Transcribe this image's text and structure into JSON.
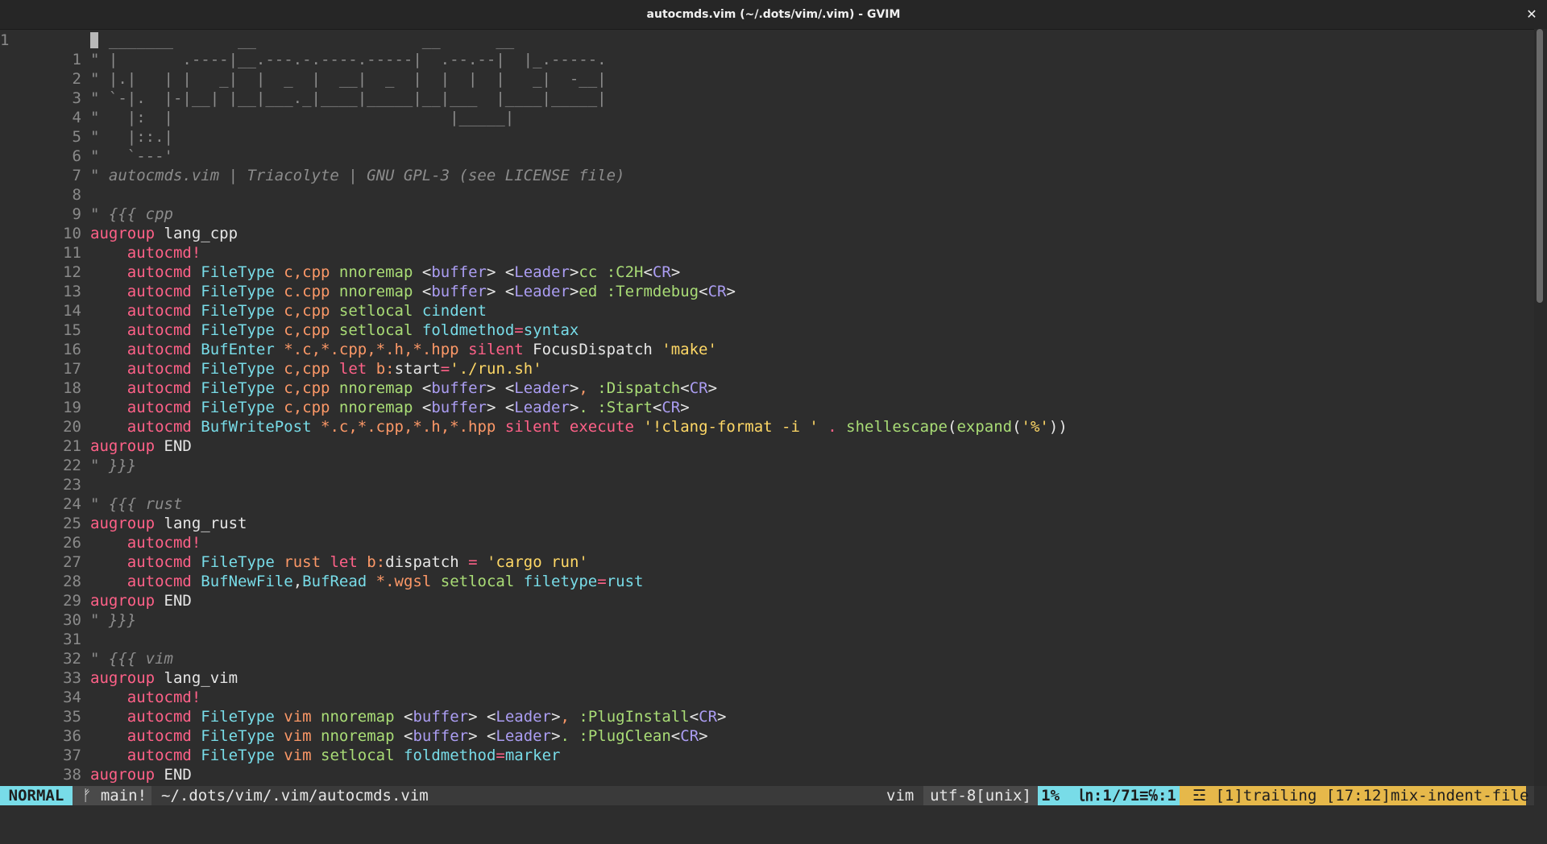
{
  "window": {
    "title": "autocmds.vim (~/.dots/vim/.vim) - GVIM"
  },
  "editor": {
    "current_line_number": "1",
    "lines": [
      {
        "n": "",
        "t": [
          [
            "c",
            "\" _______       __                  __      __"
          ]
        ]
      },
      {
        "n": "1",
        "t": [
          [
            "c",
            "\" |       .----|__.---.-.----.-----|  .--.--|  |_.-----."
          ]
        ]
      },
      {
        "n": "2",
        "t": [
          [
            "c",
            "\" |.|   | |   _|  |  _  |  __|  _  |  |  |  |   _|  -__|"
          ]
        ]
      },
      {
        "n": "3",
        "t": [
          [
            "c",
            "\" `-|.  |-|__| |__|___._|____|_____|__|___  |____|_____|"
          ]
        ]
      },
      {
        "n": "4",
        "t": [
          [
            "c",
            "\"   |:  |                              |_____|"
          ]
        ]
      },
      {
        "n": "5",
        "t": [
          [
            "c",
            "\"   |::.|"
          ]
        ]
      },
      {
        "n": "6",
        "t": [
          [
            "c",
            "\"   `---'"
          ]
        ]
      },
      {
        "n": "7",
        "t": [
          [
            "ci",
            "\" autocmds.vim | Triacolyte | GNU GPL-3 (see LICENSE file)"
          ]
        ]
      },
      {
        "n": "8",
        "t": []
      },
      {
        "n": "9",
        "t": [
          [
            "ci",
            "\" {{{ cpp"
          ]
        ]
      },
      {
        "n": "10",
        "t": [
          [
            "k",
            "augroup"
          ],
          [
            "w",
            " lang_cpp"
          ]
        ]
      },
      {
        "n": "11",
        "t": [
          [
            "w",
            "    "
          ],
          [
            "k",
            "autocmd!"
          ]
        ]
      },
      {
        "n": "12",
        "t": [
          [
            "w",
            "    "
          ],
          [
            "k",
            "autocmd"
          ],
          [
            "w",
            " "
          ],
          [
            "t",
            "FileType"
          ],
          [
            "w",
            " "
          ],
          [
            "v",
            "c,cpp"
          ],
          [
            "w",
            " "
          ],
          [
            "f",
            "nnoremap"
          ],
          [
            "w",
            " <"
          ],
          [
            "m",
            "buffer"
          ],
          [
            "w",
            "> <"
          ],
          [
            "m",
            "Leader"
          ],
          [
            "w",
            ">"
          ],
          [
            "f",
            "cc :C2H"
          ],
          [
            "w",
            "<"
          ],
          [
            "m",
            "CR"
          ],
          [
            "w",
            ">"
          ]
        ]
      },
      {
        "n": "13",
        "t": [
          [
            "w",
            "    "
          ],
          [
            "k",
            "autocmd"
          ],
          [
            "w",
            " "
          ],
          [
            "t",
            "FileType"
          ],
          [
            "w",
            " "
          ],
          [
            "v",
            "c.cpp"
          ],
          [
            "w",
            " "
          ],
          [
            "f",
            "nnoremap"
          ],
          [
            "w",
            " <"
          ],
          [
            "m",
            "buffer"
          ],
          [
            "w",
            "> <"
          ],
          [
            "m",
            "Leader"
          ],
          [
            "w",
            ">"
          ],
          [
            "f",
            "ed :Termdebug"
          ],
          [
            "w",
            "<"
          ],
          [
            "m",
            "CR"
          ],
          [
            "w",
            ">"
          ]
        ]
      },
      {
        "n": "14",
        "t": [
          [
            "w",
            "    "
          ],
          [
            "k",
            "autocmd"
          ],
          [
            "w",
            " "
          ],
          [
            "t",
            "FileType"
          ],
          [
            "w",
            " "
          ],
          [
            "v",
            "c,cpp"
          ],
          [
            "w",
            " "
          ],
          [
            "f",
            "setlocal"
          ],
          [
            "w",
            " "
          ],
          [
            "t",
            "cindent"
          ]
        ]
      },
      {
        "n": "15",
        "t": [
          [
            "w",
            "    "
          ],
          [
            "k",
            "autocmd"
          ],
          [
            "w",
            " "
          ],
          [
            "t",
            "FileType"
          ],
          [
            "w",
            " "
          ],
          [
            "v",
            "c,cpp"
          ],
          [
            "w",
            " "
          ],
          [
            "f",
            "setlocal"
          ],
          [
            "w",
            " "
          ],
          [
            "t",
            "foldmethod"
          ],
          [
            "k",
            "="
          ],
          [
            "t",
            "syntax"
          ]
        ]
      },
      {
        "n": "16",
        "t": [
          [
            "w",
            "    "
          ],
          [
            "k",
            "autocmd"
          ],
          [
            "w",
            " "
          ],
          [
            "t",
            "BufEnter"
          ],
          [
            "w",
            " "
          ],
          [
            "v",
            "*.c,*.cpp,*.h,*.hpp"
          ],
          [
            "w",
            " "
          ],
          [
            "k",
            "silent"
          ],
          [
            "w",
            " FocusDispatch "
          ],
          [
            "s",
            "'make'"
          ]
        ]
      },
      {
        "n": "17",
        "t": [
          [
            "w",
            "    "
          ],
          [
            "k",
            "autocmd"
          ],
          [
            "w",
            " "
          ],
          [
            "t",
            "FileType"
          ],
          [
            "w",
            " "
          ],
          [
            "v",
            "c,cpp"
          ],
          [
            "w",
            " "
          ],
          [
            "k",
            "let"
          ],
          [
            "w",
            " "
          ],
          [
            "v",
            "b:"
          ],
          [
            "w",
            "start"
          ],
          [
            "k",
            "="
          ],
          [
            "s",
            "'./run.sh'"
          ]
        ]
      },
      {
        "n": "18",
        "t": [
          [
            "w",
            "    "
          ],
          [
            "k",
            "autocmd"
          ],
          [
            "w",
            " "
          ],
          [
            "t",
            "FileType"
          ],
          [
            "w",
            " "
          ],
          [
            "v",
            "c,cpp"
          ],
          [
            "w",
            " "
          ],
          [
            "f",
            "nnoremap"
          ],
          [
            "w",
            " <"
          ],
          [
            "m",
            "buffer"
          ],
          [
            "w",
            "> <"
          ],
          [
            "m",
            "Leader"
          ],
          [
            "w",
            ">"
          ],
          [
            "v",
            ","
          ],
          [
            "f",
            " :Dispatch"
          ],
          [
            "w",
            "<"
          ],
          [
            "m",
            "CR"
          ],
          [
            "w",
            ">"
          ]
        ]
      },
      {
        "n": "19",
        "t": [
          [
            "w",
            "    "
          ],
          [
            "k",
            "autocmd"
          ],
          [
            "w",
            " "
          ],
          [
            "t",
            "FileType"
          ],
          [
            "w",
            " "
          ],
          [
            "v",
            "c,cpp"
          ],
          [
            "w",
            " "
          ],
          [
            "f",
            "nnoremap"
          ],
          [
            "w",
            " <"
          ],
          [
            "m",
            "buffer"
          ],
          [
            "w",
            "> <"
          ],
          [
            "m",
            "Leader"
          ],
          [
            "w",
            ">"
          ],
          [
            "f",
            ". :Start"
          ],
          [
            "w",
            "<"
          ],
          [
            "m",
            "CR"
          ],
          [
            "w",
            ">"
          ]
        ]
      },
      {
        "n": "20",
        "t": [
          [
            "w",
            "    "
          ],
          [
            "k",
            "autocmd"
          ],
          [
            "w",
            " "
          ],
          [
            "t",
            "BufWritePost"
          ],
          [
            "w",
            " "
          ],
          [
            "v",
            "*.c,*.cpp,*.h,*.hpp"
          ],
          [
            "w",
            " "
          ],
          [
            "k",
            "silent"
          ],
          [
            "w",
            " "
          ],
          [
            "k",
            "execute"
          ],
          [
            "w",
            " "
          ],
          [
            "s",
            "'!clang-format -i '"
          ],
          [
            "w",
            " "
          ],
          [
            "k",
            "."
          ],
          [
            "w",
            " "
          ],
          [
            "f",
            "shellescape"
          ],
          [
            "w",
            "("
          ],
          [
            "f",
            "expand"
          ],
          [
            "w",
            "("
          ],
          [
            "s",
            "'%'"
          ],
          [
            "w",
            "))"
          ]
        ]
      },
      {
        "n": "21",
        "t": [
          [
            "k",
            "augroup"
          ],
          [
            "w",
            " END"
          ]
        ]
      },
      {
        "n": "22",
        "t": [
          [
            "ci",
            "\" }}}"
          ]
        ]
      },
      {
        "n": "23",
        "t": []
      },
      {
        "n": "24",
        "t": [
          [
            "ci",
            "\" {{{ rust"
          ]
        ]
      },
      {
        "n": "25",
        "t": [
          [
            "k",
            "augroup"
          ],
          [
            "w",
            " lang_rust"
          ]
        ]
      },
      {
        "n": "26",
        "t": [
          [
            "w",
            "    "
          ],
          [
            "k",
            "autocmd!"
          ]
        ]
      },
      {
        "n": "27",
        "t": [
          [
            "w",
            "    "
          ],
          [
            "k",
            "autocmd"
          ],
          [
            "w",
            " "
          ],
          [
            "t",
            "FileType"
          ],
          [
            "w",
            " "
          ],
          [
            "v",
            "rust"
          ],
          [
            "w",
            " "
          ],
          [
            "k",
            "let"
          ],
          [
            "w",
            " "
          ],
          [
            "v",
            "b:"
          ],
          [
            "w",
            "dispatch "
          ],
          [
            "k",
            "="
          ],
          [
            "w",
            " "
          ],
          [
            "s",
            "'cargo run'"
          ]
        ]
      },
      {
        "n": "28",
        "t": [
          [
            "w",
            "    "
          ],
          [
            "k",
            "autocmd"
          ],
          [
            "w",
            " "
          ],
          [
            "t",
            "BufNewFile"
          ],
          [
            "w",
            ","
          ],
          [
            "t",
            "BufRead"
          ],
          [
            "w",
            " "
          ],
          [
            "v",
            "*.wgsl"
          ],
          [
            "w",
            " "
          ],
          [
            "f",
            "setlocal"
          ],
          [
            "w",
            " "
          ],
          [
            "t",
            "filetype"
          ],
          [
            "k",
            "="
          ],
          [
            "t",
            "rust"
          ]
        ]
      },
      {
        "n": "29",
        "t": [
          [
            "k",
            "augroup"
          ],
          [
            "w",
            " END"
          ]
        ]
      },
      {
        "n": "30",
        "t": [
          [
            "ci",
            "\" }}}"
          ]
        ]
      },
      {
        "n": "31",
        "t": []
      },
      {
        "n": "32",
        "t": [
          [
            "ci",
            "\" {{{ vim"
          ]
        ]
      },
      {
        "n": "33",
        "t": [
          [
            "k",
            "augroup"
          ],
          [
            "w",
            " lang_vim"
          ]
        ]
      },
      {
        "n": "34",
        "t": [
          [
            "w",
            "    "
          ],
          [
            "k",
            "autocmd!"
          ]
        ]
      },
      {
        "n": "35",
        "t": [
          [
            "w",
            "    "
          ],
          [
            "k",
            "autocmd"
          ],
          [
            "w",
            " "
          ],
          [
            "t",
            "FileType"
          ],
          [
            "w",
            " "
          ],
          [
            "v",
            "vim"
          ],
          [
            "w",
            " "
          ],
          [
            "f",
            "nnoremap"
          ],
          [
            "w",
            " <"
          ],
          [
            "m",
            "buffer"
          ],
          [
            "w",
            "> <"
          ],
          [
            "m",
            "Leader"
          ],
          [
            "w",
            ">"
          ],
          [
            "v",
            ","
          ],
          [
            "f",
            " :PlugInstall"
          ],
          [
            "w",
            "<"
          ],
          [
            "m",
            "CR"
          ],
          [
            "w",
            ">"
          ]
        ]
      },
      {
        "n": "36",
        "t": [
          [
            "w",
            "    "
          ],
          [
            "k",
            "autocmd"
          ],
          [
            "w",
            " "
          ],
          [
            "t",
            "FileType"
          ],
          [
            "w",
            " "
          ],
          [
            "v",
            "vim"
          ],
          [
            "w",
            " "
          ],
          [
            "f",
            "nnoremap"
          ],
          [
            "w",
            " <"
          ],
          [
            "m",
            "buffer"
          ],
          [
            "w",
            "> <"
          ],
          [
            "m",
            "Leader"
          ],
          [
            "w",
            ">"
          ],
          [
            "f",
            ". :PlugClean"
          ],
          [
            "w",
            "<"
          ],
          [
            "m",
            "CR"
          ],
          [
            "w",
            ">"
          ]
        ]
      },
      {
        "n": "37",
        "t": [
          [
            "w",
            "    "
          ],
          [
            "k",
            "autocmd"
          ],
          [
            "w",
            " "
          ],
          [
            "t",
            "FileType"
          ],
          [
            "w",
            " "
          ],
          [
            "v",
            "vim"
          ],
          [
            "w",
            " "
          ],
          [
            "f",
            "setlocal"
          ],
          [
            "w",
            " "
          ],
          [
            "t",
            "foldmethod"
          ],
          [
            "k",
            "="
          ],
          [
            "t",
            "marker"
          ]
        ]
      },
      {
        "n": "38",
        "t": [
          [
            "k",
            "augroup"
          ],
          [
            "w",
            " END"
          ]
        ]
      }
    ]
  },
  "statusline": {
    "mode": "NORMAL",
    "branch": "ᚠ main!",
    "filepath": "~/.dots/vim/.vim/autocmds.vim",
    "filetype": "vim",
    "encoding": "utf-8[unix]",
    "position": "1%  ㏑:1/71≡℅:1",
    "warnings": "☲ [1]trailing [17:12]mix-indent-file"
  },
  "scrollbar": {
    "position_fraction": 0.0
  },
  "colors": {
    "background": "#2d2d2d",
    "keyword": "#ff6188",
    "type": "#78dce8",
    "value": "#fc9867",
    "string": "#ffd866",
    "function": "#a9dc76",
    "special": "#ab9df2",
    "comment": "#8c8c8c",
    "mode_bg": "#78dce8",
    "warning_bg": "#e6b84a"
  }
}
